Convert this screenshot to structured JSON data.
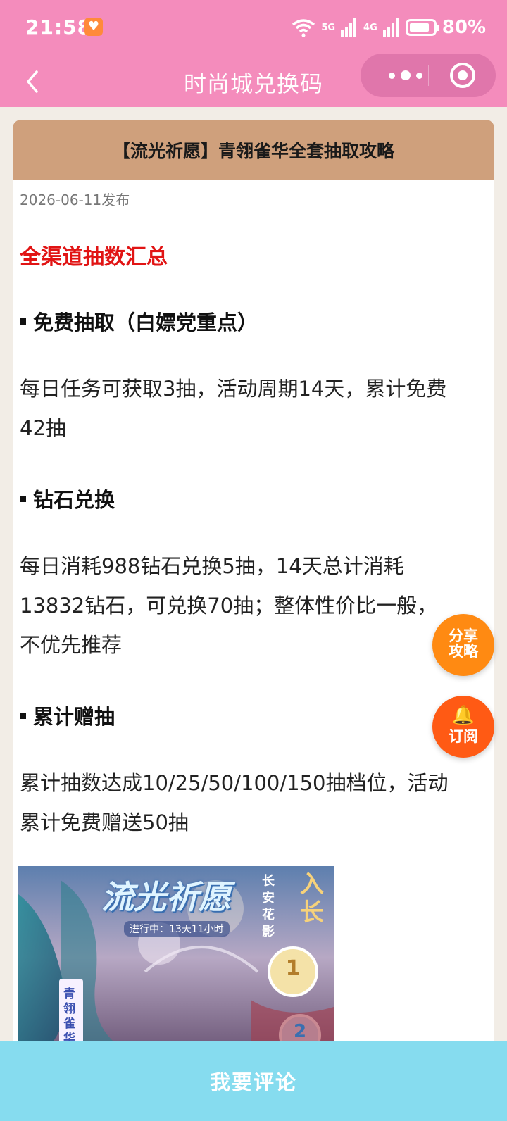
{
  "status_bar": {
    "time": "21:58",
    "signals": [
      "6",
      "5G",
      "4G"
    ],
    "battery": "80%"
  },
  "nav": {
    "title": "时尚城兑换码"
  },
  "article": {
    "title": "【流光祈愿】青翎雀华全套抽取攻略",
    "date": "2026-06-11发布",
    "section_title": "全渠道抽数汇总",
    "blocks": [
      {
        "heading": "免费抽取（白嫖党重点）",
        "lines": [
          "每日任务可获取3抽，活动周期14天，累计免费",
          "42抽"
        ]
      },
      {
        "heading": "钻石兑换",
        "lines": [
          "每日消耗988钻石兑换5抽，14天总计消耗",
          "13832钻石，可兑换70抽；整体性价比一般，",
          "不优先推荐"
        ]
      },
      {
        "heading": "累计赠抽",
        "lines": [
          "累计抽数达成10/25/50/100/150抽档位，活动",
          "累计免费赠送50抽"
        ]
      }
    ],
    "banner": {
      "title": "流光祈愿",
      "status": "进行中：13天11小时",
      "side_text": "长安花影",
      "vertical_text": "青翎雀华",
      "right_text": "入长",
      "badge_1": "1",
      "badge_2": "2"
    }
  },
  "fabs": {
    "share_line1": "分享",
    "share_line2": "攻略",
    "subscribe": "订阅"
  },
  "bottom": {
    "comment": "我要评论"
  },
  "colors": {
    "header_pink": "#f48cbc",
    "card_header": "#cfa07c",
    "section_red": "#e11414",
    "share_orange": "#ff8a12",
    "subscribe_orange": "#ff5a14",
    "bottom_bar": "#86dcef"
  }
}
